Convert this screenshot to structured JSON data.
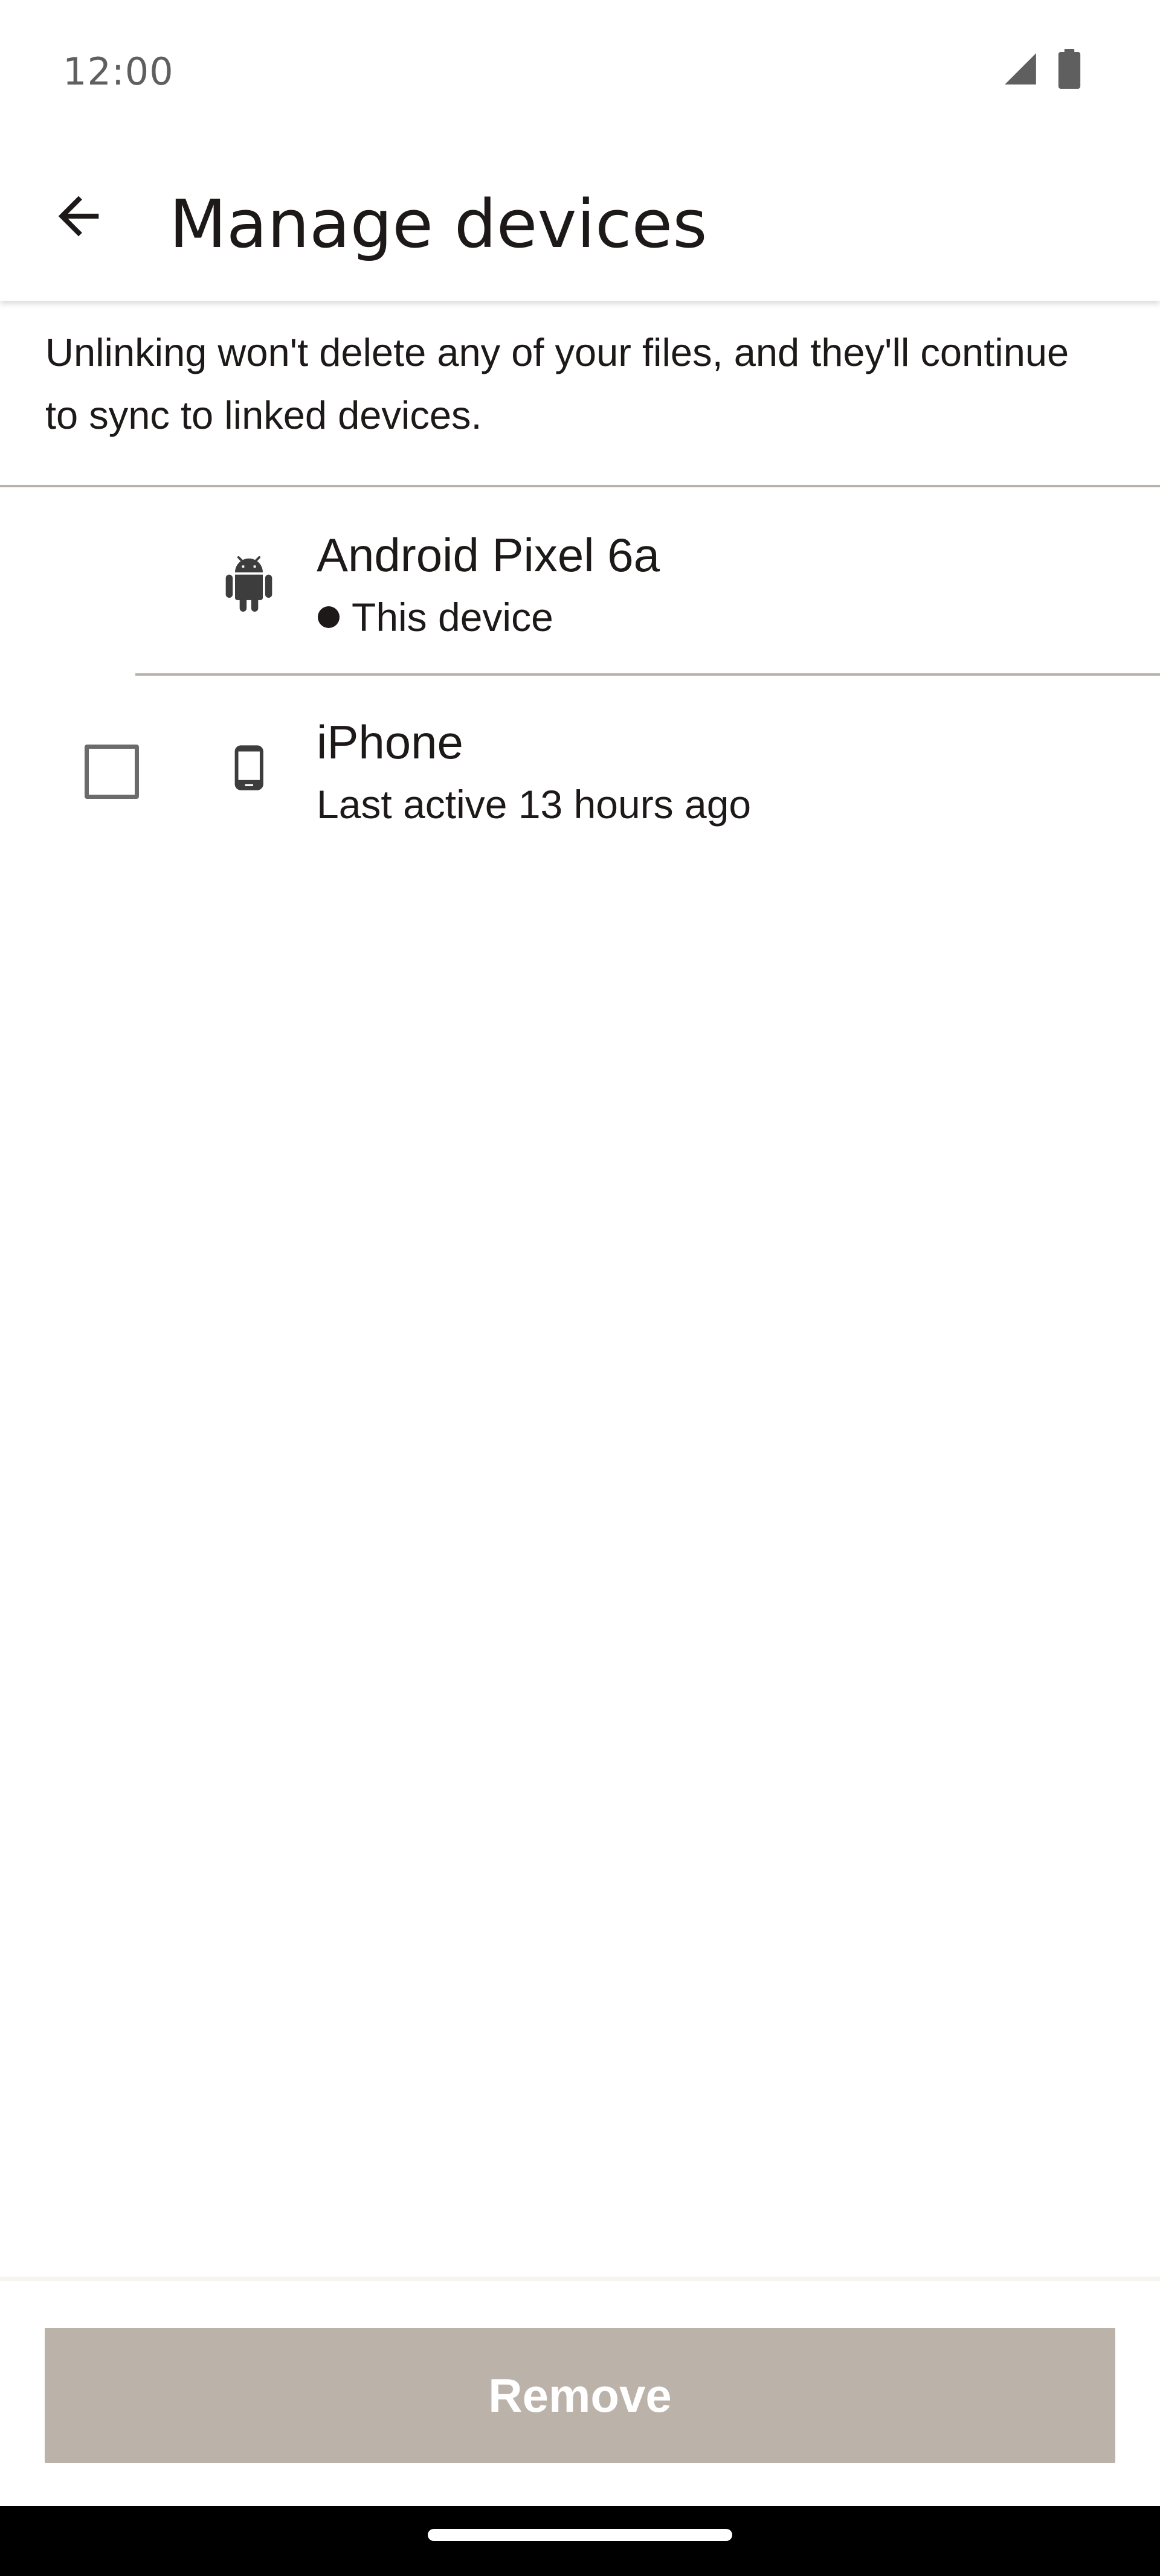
{
  "status_bar": {
    "time": "12:00",
    "icons": [
      "signal-icon",
      "battery-icon"
    ]
  },
  "app_bar": {
    "back_icon": "arrow-left-icon",
    "title": "Manage devices"
  },
  "info_text": "Unlinking won't delete any of your files, and they'll continue to sync to linked devices.",
  "devices": [
    {
      "name": "Android Pixel 6a",
      "subtitle": "This device",
      "icon": "android-icon",
      "current": true,
      "checkbox": false
    },
    {
      "name": "iPhone",
      "subtitle": "Last active 13 hours ago",
      "icon": "smartphone-icon",
      "current": false,
      "checkbox": true,
      "checked": false
    }
  ],
  "actions": {
    "remove_label": "Remove",
    "remove_enabled": false
  },
  "colors": {
    "text": "#1e1919",
    "divider": "#b8b2ab",
    "button_disabled": "#bbb2aa",
    "icon": "#3d3d3d"
  }
}
